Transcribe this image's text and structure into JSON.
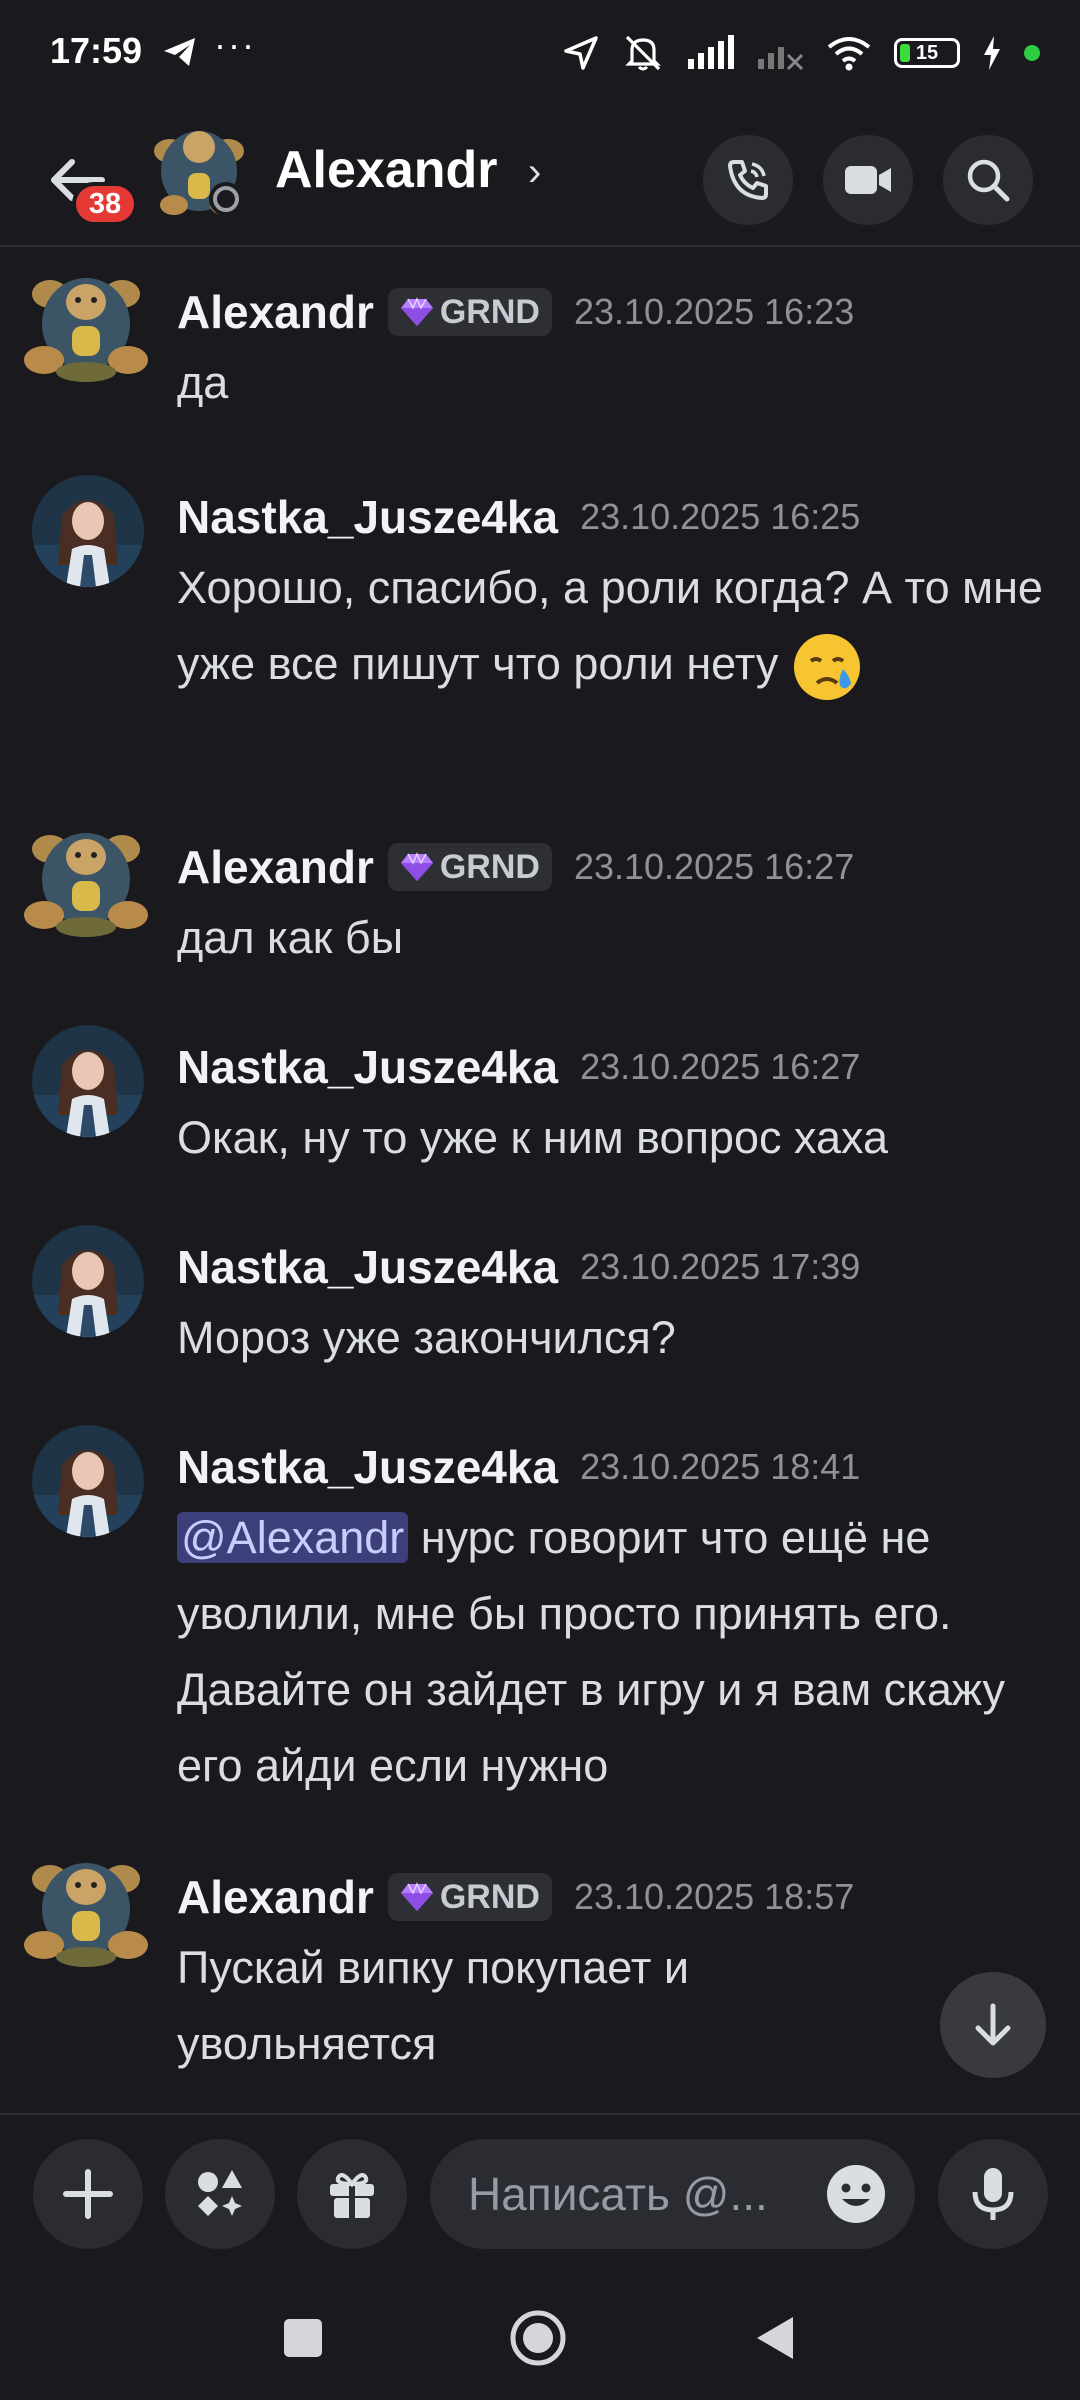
{
  "status_bar": {
    "time": "17:59",
    "more": "···",
    "battery": "15",
    "icons": [
      "telegram-icon",
      "location-icon",
      "mute-icon",
      "signal-icon",
      "signal-off-icon",
      "wifi-icon",
      "battery-icon",
      "charging-icon",
      "dot-indicator"
    ]
  },
  "header": {
    "title": "Alexandr",
    "chevron": "›",
    "unread_count": "38",
    "actions": [
      "voice-call-icon",
      "video-call-icon",
      "search-icon"
    ]
  },
  "messages": [
    {
      "author": "Alexandr",
      "tag": "GRND",
      "time": "23.10.2025 16:23",
      "text": "да"
    },
    {
      "author": "Nastka_Jusze4ka",
      "time": "23.10.2025 16:25",
      "text": "Хорошо, спасибо, а роли когда? А то мне уже все пишут что роли нету"
    },
    {
      "author": "Alexandr",
      "tag": "GRND",
      "time": "23.10.2025 16:27",
      "text": "дал как бы"
    },
    {
      "author": "Nastka_Jusze4ka",
      "time": "23.10.2025 16:27",
      "text": "Окак, ну то уже к ним вопрос хаха"
    },
    {
      "author": "Nastka_Jusze4ka",
      "time": "23.10.2025 17:39",
      "text": "Мороз уже закончился?"
    },
    {
      "author": "Nastka_Jusze4ka",
      "time": "23.10.2025 18:41",
      "mention": "@Alexandr",
      "text": " нурс говорит что ещё не уволили, мне бы просто принять его. Давайте он зайдет в игру и я вам скажу его айди если нужно"
    },
    {
      "author": "Alexandr",
      "tag": "GRND",
      "time": "23.10.2025 18:57",
      "text": "Пускай випку покупает и увольняется"
    }
  ],
  "composer": {
    "placeholder": "Написать @...",
    "buttons": [
      "plus-icon",
      "apps-icon",
      "gift-icon",
      "emoji-icon",
      "microphone-icon"
    ]
  },
  "colors": {
    "background": "#1a1a1e",
    "surface": "#2b2c31",
    "badge": "#e53935",
    "mention_bg": "#3c3f7a",
    "timestamp": "#8e9297"
  }
}
